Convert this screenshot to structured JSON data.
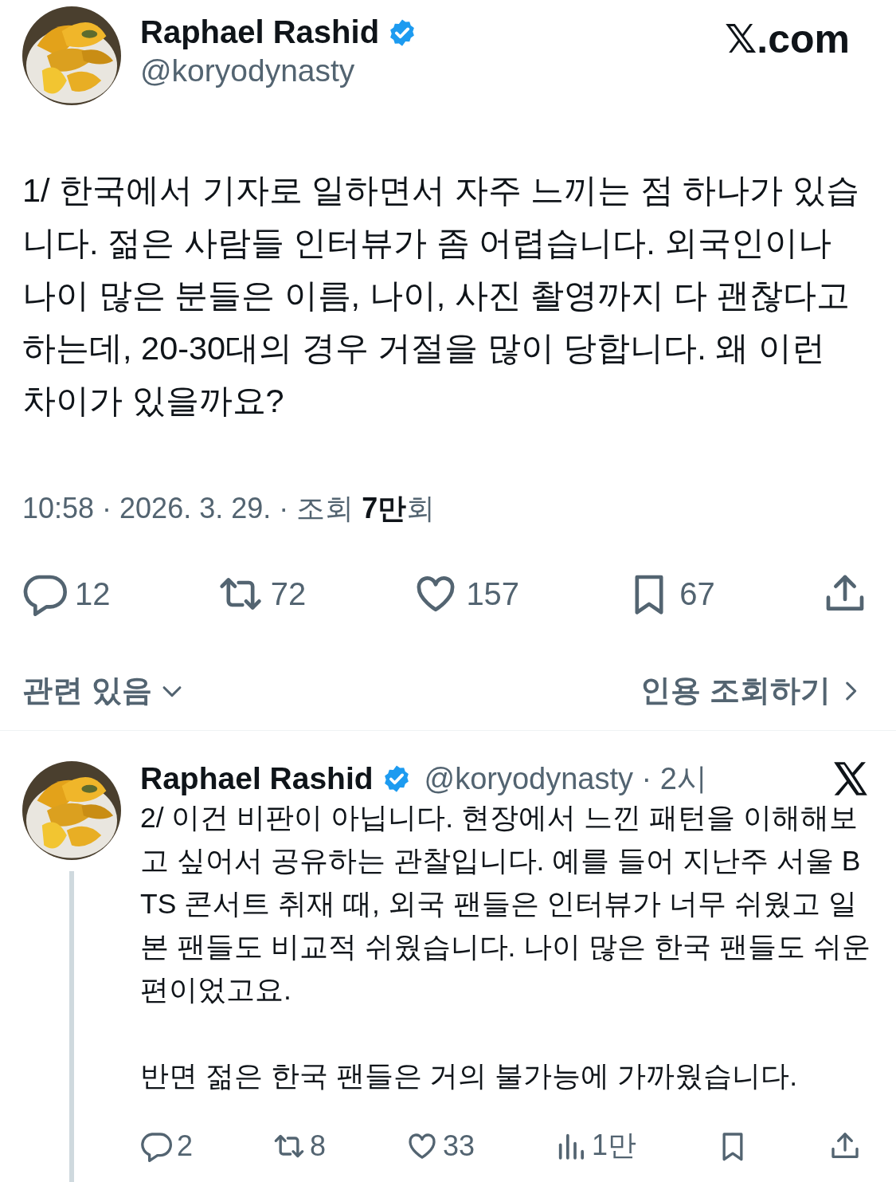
{
  "main_tweet": {
    "author": {
      "name": "Raphael Rashid",
      "verified": true,
      "handle": "@koryodynasty"
    },
    "site": "𝕏.com",
    "text": "1/ 한국에서 기자로 일하면서 자주 느끼는 점 하나가 있습니다. 젊은 사람들 인터뷰가 좀 어렵습니다. 외국인이나 나이 많은 분들은 이름, 나이, 사진 촬영까지 다 괜찮다고 하는데, 20-30대의 경우 거절을 많이 당합니다. 왜 이런 차이가 있을까요?",
    "meta": "10:58 · 2026. 3. 29. · 조회 **7만**회",
    "actions": [
      {
        "kind": "reply",
        "count": "12"
      },
      {
        "kind": "retweet",
        "count": "72"
      },
      {
        "kind": "like",
        "count": "157"
      },
      {
        "kind": "bookmark",
        "count": "67"
      },
      {
        "kind": "share"
      }
    ],
    "related": "관련 있음",
    "quotes": "인용 조회하기"
  },
  "reply_tweet": {
    "author": {
      "name": "Raphael Rashid",
      "verified": true,
      "handle": "@koryodynasty · 2시"
    },
    "paragraphs": [
      "2/ 이건 비판이 아닙니다. 현장에서 느낀 패턴을 이해해보고 싶어서 공유하는 관찰입니다. 예를 들어 지난주 서울 BTS 콘서트 취재 때, 외국 팬들은 인터뷰가 너무 쉬웠고 일본 팬들도 비교적 쉬웠습니다. 나이 많은 한국 팬들도 쉬운 편이었고요.",
      "반면 젊은 한국 팬들은 거의 불가능에 가까웠습니다."
    ],
    "actions": [
      {
        "kind": "reply",
        "count": "2"
      },
      {
        "kind": "retweet",
        "count": "8"
      },
      {
        "kind": "like",
        "count": "33"
      },
      {
        "kind": "views",
        "count": "1만"
      },
      {
        "kind": "bookmark"
      },
      {
        "kind": "share"
      }
    ]
  }
}
